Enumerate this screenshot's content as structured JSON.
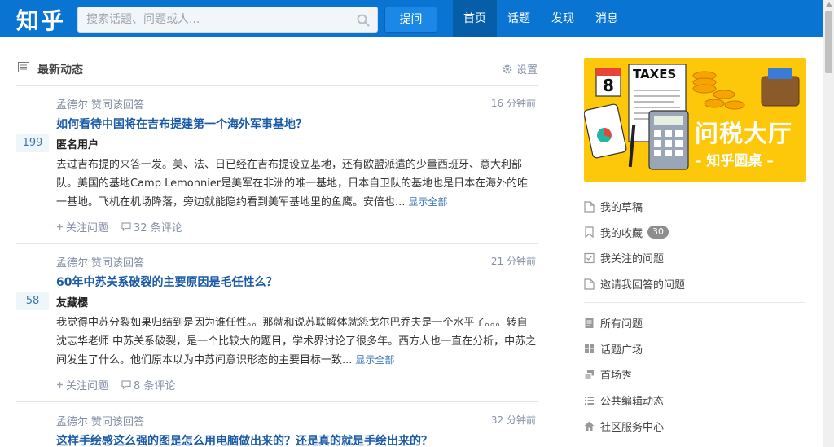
{
  "header": {
    "logo": "知乎",
    "search_placeholder": "搜索话题、问题或人...",
    "ask_label": "提问",
    "nav": [
      {
        "label": "首页",
        "active": true
      },
      {
        "label": "话题",
        "active": false
      },
      {
        "label": "发现",
        "active": false
      },
      {
        "label": "消息",
        "active": false
      }
    ]
  },
  "feed": {
    "title": "最新动态",
    "settings_label": "设置",
    "items": [
      {
        "actor": "孟德尔",
        "action": "赞同该回答",
        "time": "16 分钟前",
        "question": "如何看待中国将在吉布提建第一个海外军事基地？",
        "votes": "199",
        "author": "匿名用户",
        "excerpt": "去过吉布提的来答一发。美、法、日已经在吉布提设立基地，还有欧盟派遣的少量西班牙、意大利部队。美国的基地Camp Lemonnier是美军在非洲的唯一基地，日本自卫队的基地也是日本在海外的唯一基地。飞机在机场降落，旁边就能隐约看到美军基地里的鱼鹰。安倍也...",
        "show_all": "显示全部",
        "follow_label": "关注问题",
        "comments": "32 条评论"
      },
      {
        "actor": "孟德尔",
        "action": "赞同该回答",
        "time": "21 分钟前",
        "question": "60年中苏关系破裂的主要原因是毛任性么？",
        "votes": "58",
        "author": "友藏樱",
        "excerpt": "我觉得中苏分裂如果归结到是因为谁任性。。那就和说苏联解体就怨戈尔巴乔夫是一个水平了。。。转自沈志华老师 中苏关系破裂，是一个比较大的题目，学术界讨论了很多年。西方人也一直在分析，中苏之间发生了什么。他们原本以为中苏间意识形态的主要目标一致...",
        "show_all": "显示全部",
        "follow_label": "关注问题",
        "comments": "8 条评论"
      },
      {
        "actor": "孟德尔",
        "action": "赞同该回答",
        "time": "32 分钟前",
        "question": "这样手绘感这么强的图是怎么用电脑做出来的？还是真的就是手绘出来的？"
      }
    ]
  },
  "sidebar": {
    "banner": {
      "calendar_number": "8",
      "taxes_label": "TAXES",
      "title": "问税大厅",
      "subtitle": "– 知乎圆桌 –"
    },
    "group1": [
      {
        "label": "我的草稿",
        "icon": "draft-icon"
      },
      {
        "label": "我的收藏",
        "icon": "bookmark-icon",
        "badge": "30"
      },
      {
        "label": "我关注的问题",
        "icon": "check-box-icon"
      },
      {
        "label": "邀请我回答的问题",
        "icon": "invite-doc-icon"
      }
    ],
    "group2": [
      {
        "label": "所有问题",
        "icon": "document-list-icon"
      },
      {
        "label": "话题广场",
        "icon": "grid-icon"
      },
      {
        "label": "首场秀",
        "icon": "layers-icon"
      },
      {
        "label": "公共编辑动态",
        "icon": "list-icon"
      },
      {
        "label": "社区服务中心",
        "icon": "home-icon"
      }
    ]
  },
  "colors": {
    "topbar": "#0a74d2",
    "link": "#1a5aa6",
    "banner": "#fec80a",
    "muted": "#8590a6"
  }
}
